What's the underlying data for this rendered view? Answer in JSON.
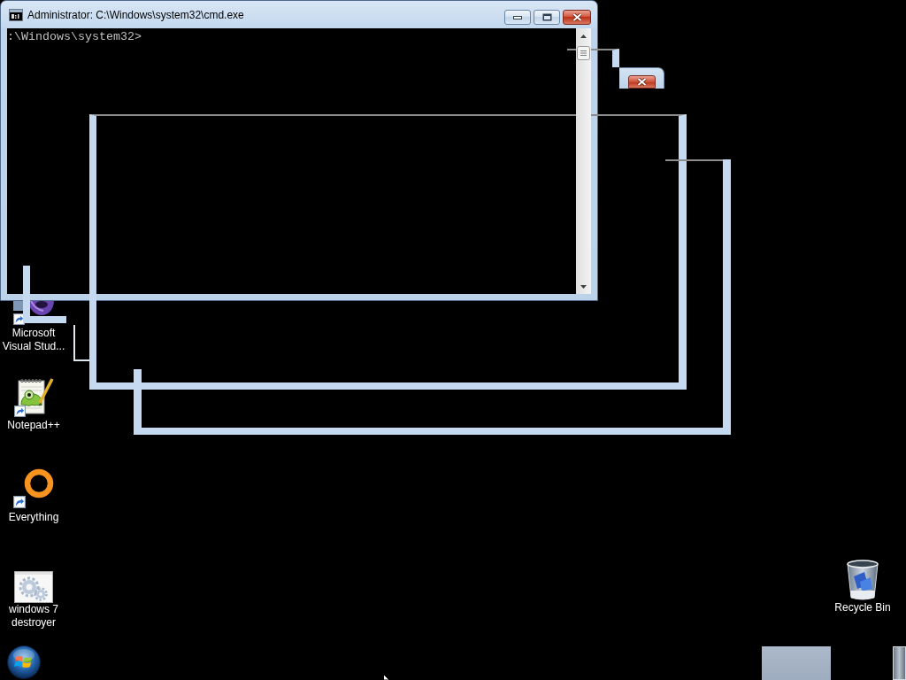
{
  "window": {
    "title": "Administrator: C:\\Windows\\system32\\cmd.exe",
    "console_lines": [
      ":\\Windows\\system32>"
    ]
  },
  "desktop_icons": [
    {
      "label": "Microsoft Visual Stud...",
      "kind": "visualstudio"
    },
    {
      "label": "Notepad++",
      "kind": "notepad"
    },
    {
      "label": "Everything",
      "kind": "everything"
    },
    {
      "label": "windows 7 destroyer",
      "kind": "program"
    }
  ],
  "recycle_bin": {
    "label": "Recycle Bin"
  }
}
